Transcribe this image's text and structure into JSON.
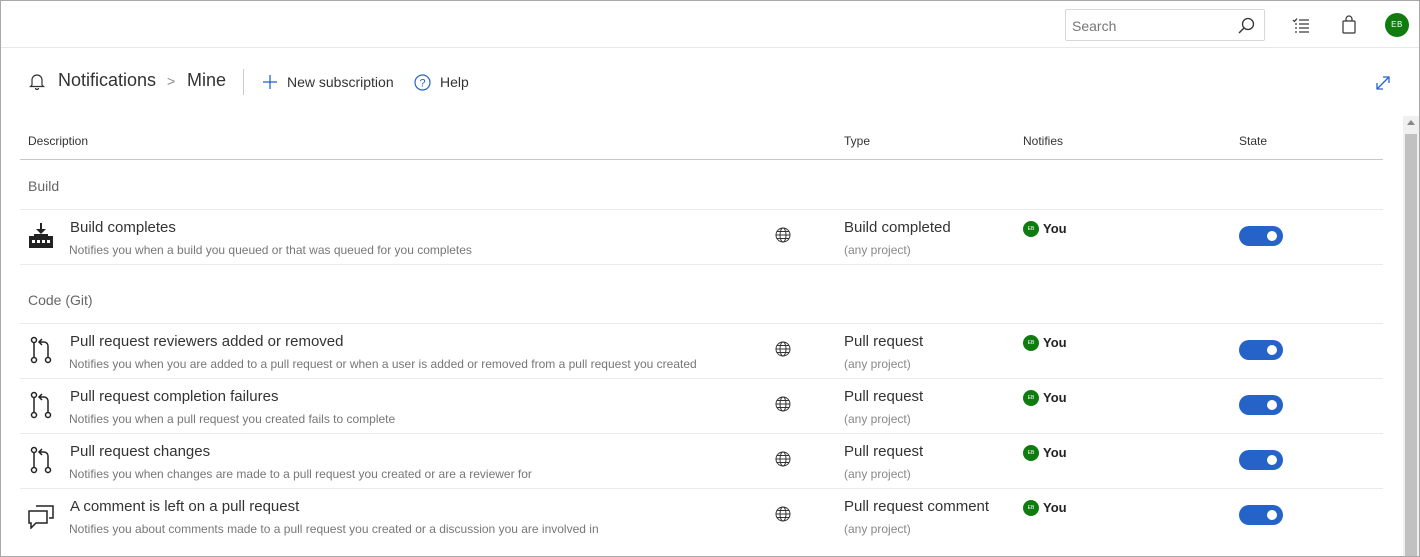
{
  "topbar": {
    "search_placeholder": "Search",
    "avatar_initials": "EB",
    "icons": [
      "search-icon",
      "task-list-icon",
      "shopping-bag-icon"
    ]
  },
  "header": {
    "crumb_root": "Notifications",
    "crumb_separator": ">",
    "crumb_current": "Mine",
    "new_subscription": "New subscription",
    "help": "Help"
  },
  "table": {
    "columns": {
      "description": "Description",
      "type": "Type",
      "notifies": "Notifies",
      "state": "State"
    },
    "groups": [
      {
        "name": "Build",
        "rows": [
          {
            "icon": "build-icon",
            "title": "Build completes",
            "desc": "Notifies you when a build you queued or that was queued for you completes",
            "type": "Build completed",
            "scope": "(any project)",
            "notifies_initials": "EB",
            "notifies": "You",
            "state_on": true
          }
        ]
      },
      {
        "name": "Code (Git)",
        "rows": [
          {
            "icon": "pull-request-icon",
            "title": "Pull request reviewers added or removed",
            "desc": "Notifies you when you are added to a pull request or when a user is added or removed from a pull request you created",
            "type": "Pull request",
            "scope": "(any project)",
            "notifies_initials": "EB",
            "notifies": "You",
            "state_on": true
          },
          {
            "icon": "pull-request-icon",
            "title": "Pull request completion failures",
            "desc": "Notifies you when a pull request you created fails to complete",
            "type": "Pull request",
            "scope": "(any project)",
            "notifies_initials": "EB",
            "notifies": "You",
            "state_on": true
          },
          {
            "icon": "pull-request-icon",
            "title": "Pull request changes",
            "desc": "Notifies you when changes are made to a pull request you created or are a reviewer for",
            "type": "Pull request",
            "scope": "(any project)",
            "notifies_initials": "EB",
            "notifies": "You",
            "state_on": true
          },
          {
            "icon": "comment-icon",
            "title": "A comment is left on a pull request",
            "desc": "Notifies you about comments made to a pull request you created or a discussion you are involved in",
            "type": "Pull request comment",
            "scope": "(any project)",
            "notifies_initials": "EB",
            "notifies": "You",
            "state_on": true
          }
        ]
      }
    ]
  },
  "colors": {
    "accent": "#2563c8",
    "avatar": "#107c10"
  }
}
